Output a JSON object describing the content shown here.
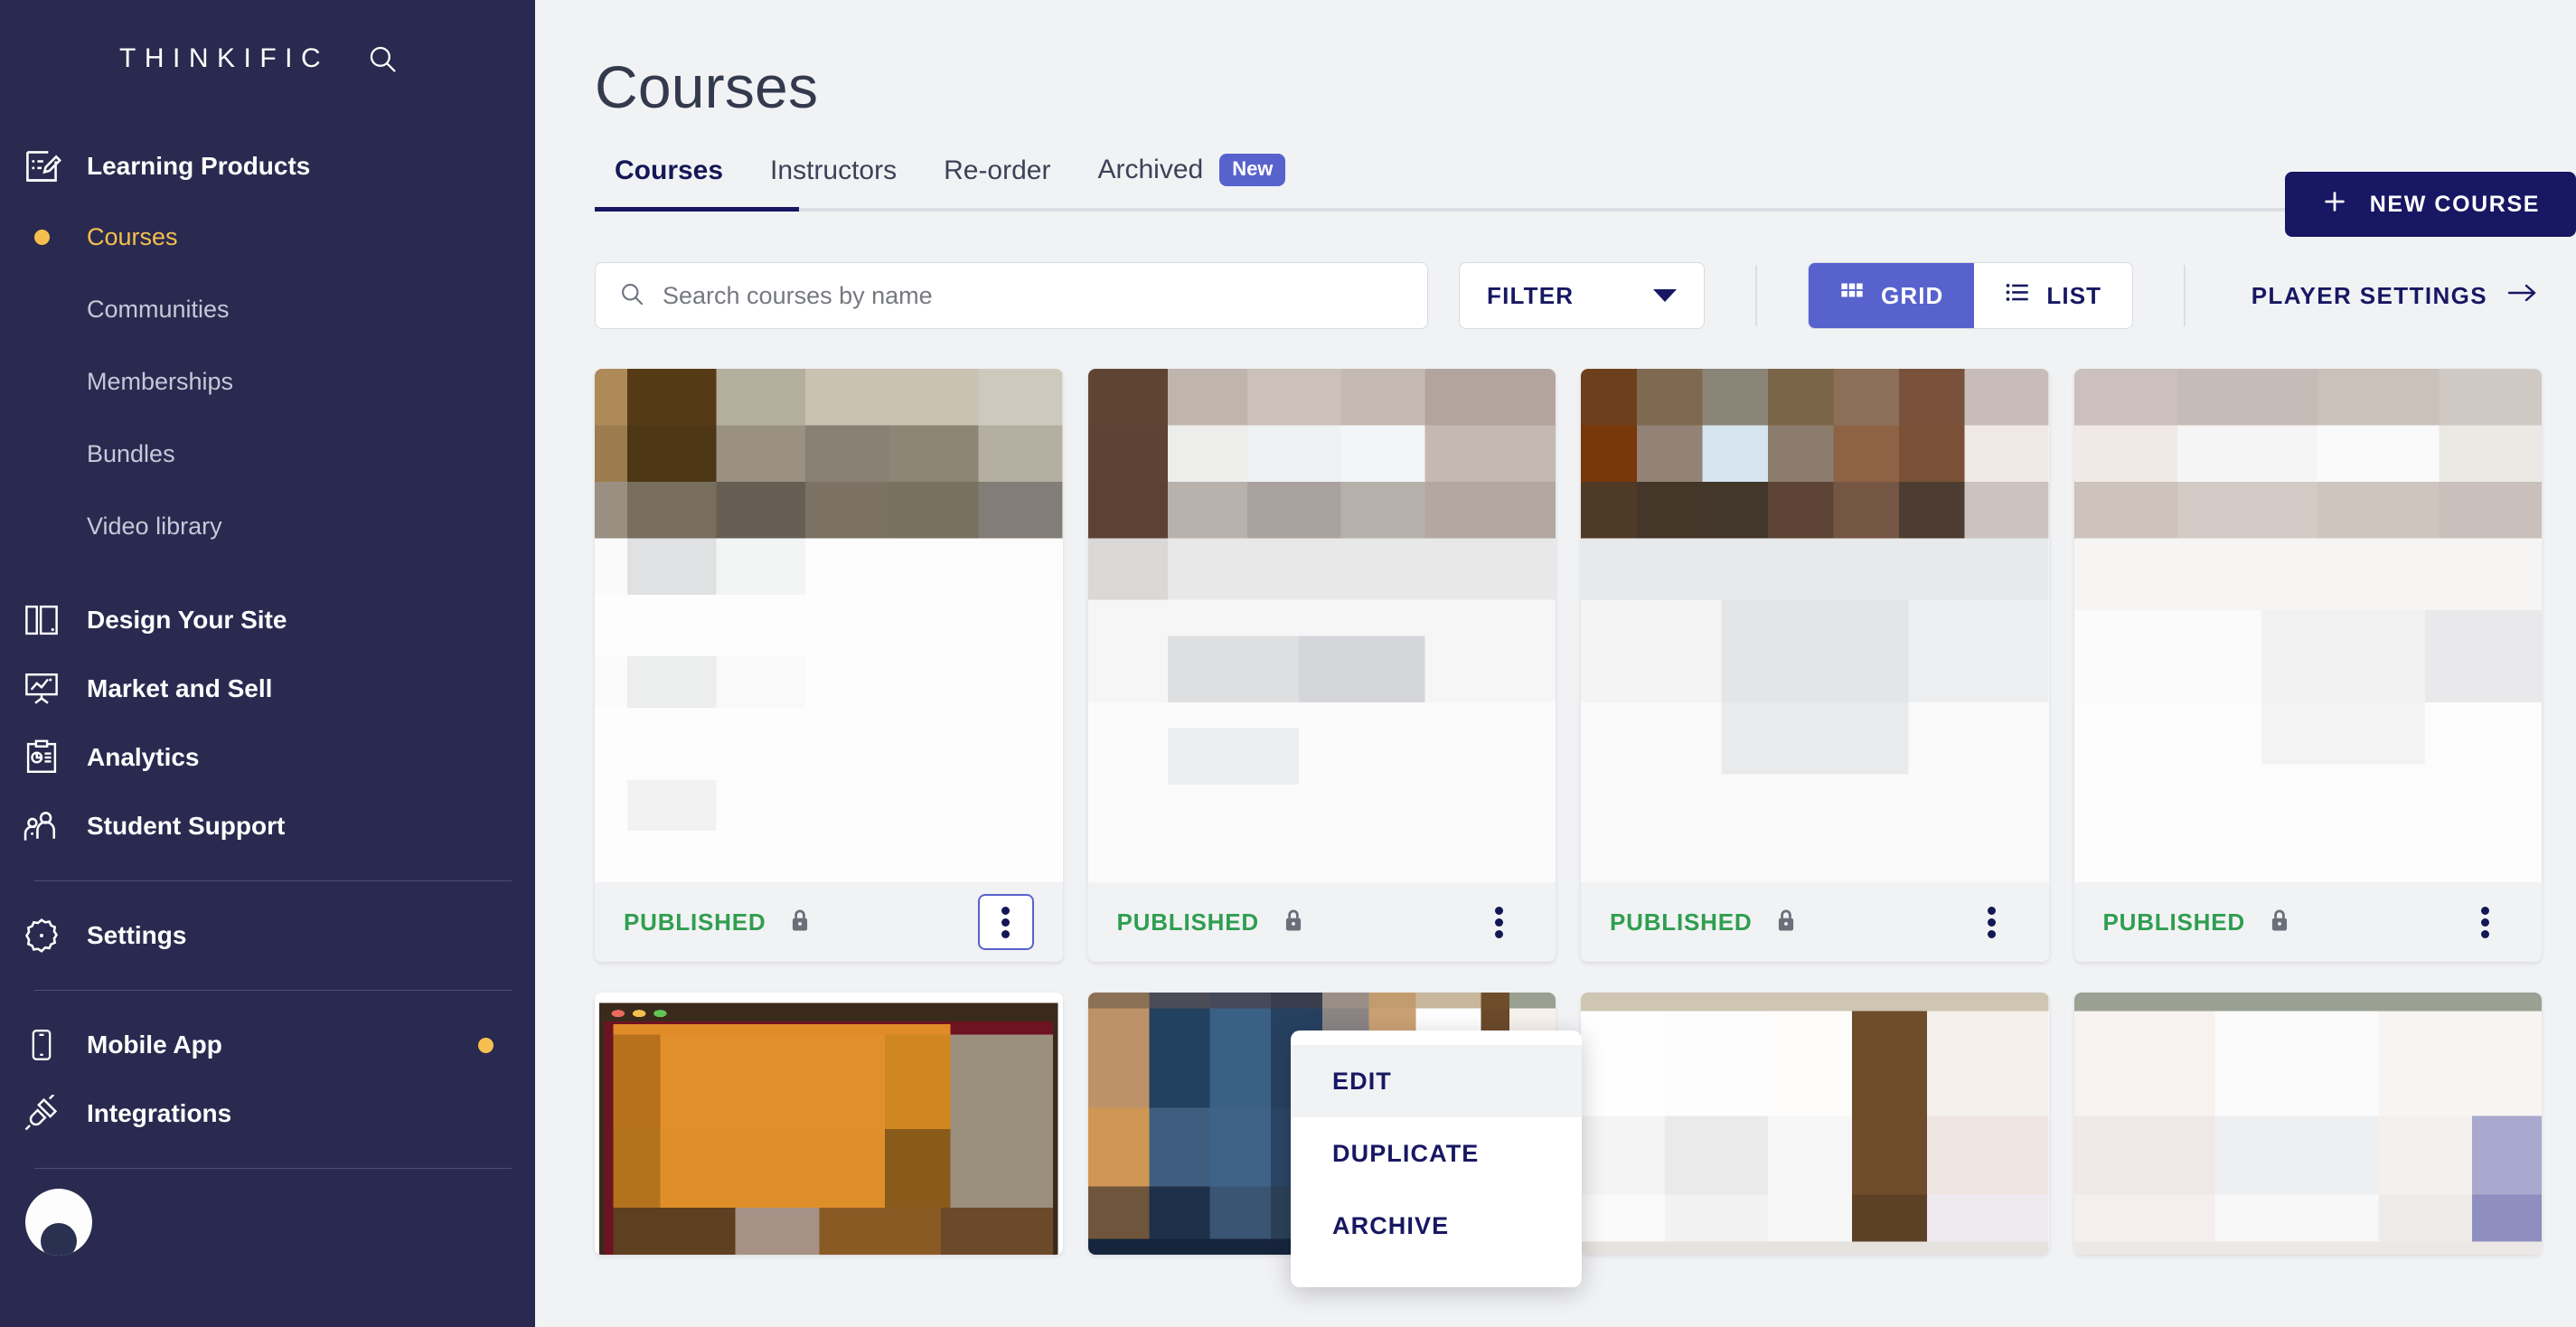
{
  "sidebar": {
    "brand": "THINKIFIC",
    "search_icon": "search-icon",
    "groups": [
      {
        "label": "Learning Products",
        "icon": "learning-products-icon",
        "children": [
          {
            "label": "Courses",
            "active": true
          },
          {
            "label": "Communities",
            "active": false
          },
          {
            "label": "Memberships",
            "active": false
          },
          {
            "label": "Bundles",
            "active": false
          },
          {
            "label": "Video library",
            "active": false
          }
        ]
      },
      {
        "label": "Design Your Site",
        "icon": "layout-icon",
        "children": []
      },
      {
        "label": "Market and Sell",
        "icon": "presentation-chart-icon",
        "children": []
      },
      {
        "label": "Analytics",
        "icon": "clipboard-chart-icon",
        "children": []
      },
      {
        "label": "Student Support",
        "icon": "people-icon",
        "children": []
      }
    ],
    "settings": {
      "label": "Settings",
      "icon": "gear-icon"
    },
    "mobile_app": {
      "label": "Mobile App",
      "icon": "phone-icon",
      "dot": true
    },
    "integrations": {
      "label": "Integrations",
      "icon": "plug-icon",
      "dot": false
    },
    "colors": {
      "bg": "#2a2a50",
      "accent": "#f6bf4f",
      "label": "#c6c8d8"
    }
  },
  "header": {
    "title": "Courses",
    "tabs": [
      {
        "label": "Courses",
        "active": true,
        "badge": ""
      },
      {
        "label": "Instructors",
        "active": false,
        "badge": ""
      },
      {
        "label": "Re-order",
        "active": false,
        "badge": ""
      },
      {
        "label": "Archived",
        "active": false,
        "badge": "New"
      }
    ],
    "new_course_label": "NEW COURSE",
    "new_course_icon": "plus-icon"
  },
  "toolbar": {
    "search_placeholder": "Search courses by name",
    "search_value": "",
    "search_icon": "search-icon",
    "filter_label": "FILTER",
    "view_grid_label": "GRID",
    "view_list_label": "LIST",
    "active_view": "GRID",
    "player_settings_label": "PLAYER SETTINGS",
    "player_settings_icon": "arrow-right-icon"
  },
  "cards": [
    {
      "status": "PUBLISHED",
      "lock_icon": "lock-icon",
      "kebab_icon": "kebab-menu-icon",
      "menu_open": true
    },
    {
      "status": "PUBLISHED",
      "lock_icon": "lock-icon",
      "kebab_icon": "kebab-menu-icon",
      "menu_open": false
    },
    {
      "status": "PUBLISHED",
      "lock_icon": "lock-icon",
      "kebab_icon": "kebab-menu-icon",
      "menu_open": false
    },
    {
      "status": "PUBLISHED",
      "lock_icon": "lock-icon",
      "kebab_icon": "kebab-menu-icon",
      "menu_open": false
    }
  ],
  "context_menu": {
    "items": [
      {
        "label": "EDIT",
        "hover": true
      },
      {
        "label": "DUPLICATE",
        "hover": false
      },
      {
        "label": "ARCHIVE",
        "hover": false
      }
    ]
  },
  "colors": {
    "brand_navy": "#171763",
    "accent_purple": "#5762cd",
    "status_green": "#2f9e4f",
    "page_bg": "#f1f2f4",
    "sidebar_bg": "#2a2a50",
    "gold": "#f6bf4f"
  }
}
